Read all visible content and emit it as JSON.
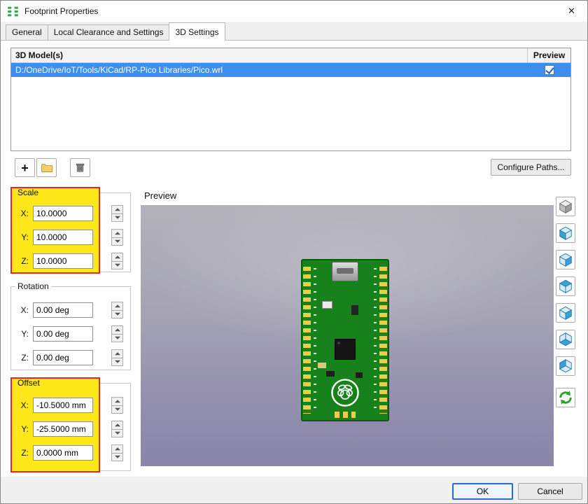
{
  "window": {
    "title": "Footprint Properties"
  },
  "icons": {
    "close": "✕",
    "add": "+"
  },
  "tabs": [
    {
      "label": "General"
    },
    {
      "label": "Local Clearance and Settings"
    },
    {
      "label": "3D Settings"
    }
  ],
  "active_tab": "3D Settings",
  "model_table": {
    "columns": {
      "model": "3D Model(s)",
      "preview": "Preview"
    },
    "rows": [
      {
        "path": "D:/OneDrive/IoT/Tools/KiCad/RP-Pico Libraries/Pico.wrl",
        "preview_checked": true,
        "selected": true
      }
    ]
  },
  "model_toolbar": {
    "configure_paths_label": "Configure Paths..."
  },
  "groups": {
    "scale": {
      "title": "Scale",
      "highlighted": true,
      "rows": [
        {
          "axis": "X:",
          "value": "10.0000"
        },
        {
          "axis": "Y:",
          "value": "10.0000"
        },
        {
          "axis": "Z:",
          "value": "10.0000"
        }
      ]
    },
    "rotation": {
      "title": "Rotation",
      "highlighted": false,
      "rows": [
        {
          "axis": "X:",
          "value": "0.00 deg"
        },
        {
          "axis": "Y:",
          "value": "0.00 deg"
        },
        {
          "axis": "Z:",
          "value": "0.00 deg"
        }
      ]
    },
    "offset": {
      "title": "Offset",
      "highlighted": true,
      "rows": [
        {
          "axis": "X:",
          "value": "-10.5000 mm"
        },
        {
          "axis": "Y:",
          "value": "-25.5000 mm"
        },
        {
          "axis": "Z:",
          "value": "0.0000 mm"
        }
      ]
    }
  },
  "preview": {
    "title": "Preview"
  },
  "view_toolbar": [
    "view-isometric",
    "view-left",
    "view-right",
    "view-top",
    "view-back",
    "view-bottom",
    "view-front",
    "refresh-view"
  ],
  "footer": {
    "ok_label": "OK",
    "cancel_label": "Cancel"
  },
  "colors": {
    "selection_blue": "#3e8ef0",
    "highlight_yellow": "#ffe81a",
    "highlight_red": "#e8261f",
    "pcb_green": "#17821c"
  }
}
